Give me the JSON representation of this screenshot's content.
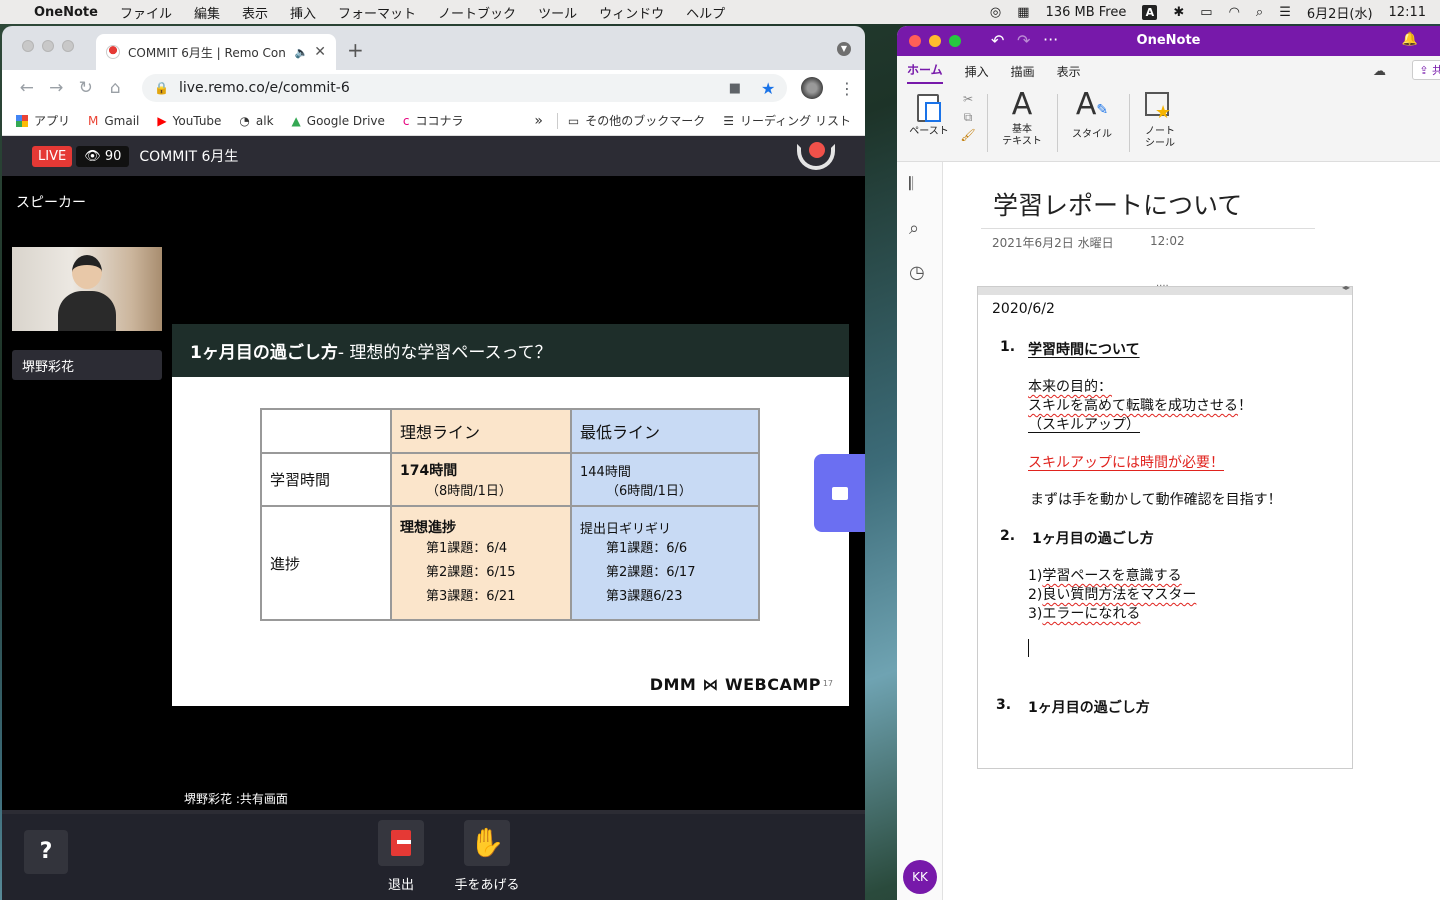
{
  "menubar": {
    "app": "OneNote",
    "items": [
      "ファイル",
      "編集",
      "表示",
      "挿入",
      "フォーマット",
      "ノートブック",
      "ツール",
      "ウィンドウ",
      "ヘルプ"
    ],
    "memory": "136 MB Free",
    "input_mode": "A",
    "date": "6月2日(水)",
    "time": "12:11"
  },
  "chrome": {
    "tab_title": "COMMIT 6月生 | Remo Con",
    "url": "live.remo.co/e/commit-6",
    "bookmarks": [
      "アプリ",
      "Gmail",
      "YouTube",
      "alk",
      "Google Drive",
      "ココナラ"
    ],
    "more_bookmarks": "その他のブックマーク",
    "reading_list": "リーディング リスト",
    "chevron": "»"
  },
  "remo": {
    "live_label": "LIVE",
    "viewer_count": "90",
    "event_title": "COMMIT 6月生",
    "speaker_section": "スピーカー",
    "speaker_name": "堺野彩花",
    "share_caption": "堺野彩花 :共有画面",
    "exit_label": "退出",
    "raise_hand_label": "手をあげる",
    "help_symbol": "?"
  },
  "slide": {
    "title_bold": "1ヶ月目の過ごし方",
    "title_rest": " - 理想的な学習ペースって？",
    "col_ideal": "理想ライン",
    "col_min": "最低ライン",
    "row_hours": "学習時間",
    "ideal_hours": "174時間",
    "ideal_hours_sub": "（8時間/1日）",
    "min_hours": "144時間",
    "min_hours_sub": "（6時間/1日）",
    "row_progress": "進捗",
    "ideal_progress_head": "理想進捗",
    "ideal_tasks": [
      "第1課題：6/4",
      "第2課題：6/15",
      "第3課題：6/21"
    ],
    "min_progress_head": "提出日ギリギリ",
    "min_tasks": [
      "第1課題：6/6",
      "第2課題：6/17",
      "第3課題6/23"
    ],
    "logo": "DMM ⋈ WEBCAMP",
    "page_number": "17"
  },
  "onenote": {
    "window_title": "OneNote",
    "tabs": [
      "ホーム",
      "挿入",
      "描画",
      "表示"
    ],
    "share_label": "共",
    "ribbon": {
      "paste": "ペースト",
      "basic_text_1": "基本",
      "basic_text_2": "テキスト",
      "styles": "スタイル",
      "tags_1": "ノート",
      "tags_2": "シール"
    },
    "avatar": "KK",
    "page_title": "学習レポートについて",
    "page_date": "2021年6月2日 水曜日",
    "page_time": "12:02",
    "note": {
      "date": "2020/6/2",
      "h1_num": "1.",
      "h1": "学習時間について",
      "purpose_label": "本来の目的：",
      "purpose_1": "スキルを高めて転職を成功させる",
      "purpose_1_end": "！",
      "purpose_2": "（スキルアップ）",
      "red_line": "スキルアップには時間が必要！",
      "action": "まずは手を動かして動作確認を目指す！",
      "h2_num": "2.",
      "h2": "1ヶ月目の過ごし方",
      "item_1_num": "1)",
      "item_1": "学習ペースを意識する",
      "item_2_num": "2)",
      "item_2": "良い質問方法をマスター",
      "item_3_num": "3)",
      "item_3": "エラーになれる",
      "h3_num": "3.",
      "h3": "1ヶ月目の過ごし方"
    }
  }
}
